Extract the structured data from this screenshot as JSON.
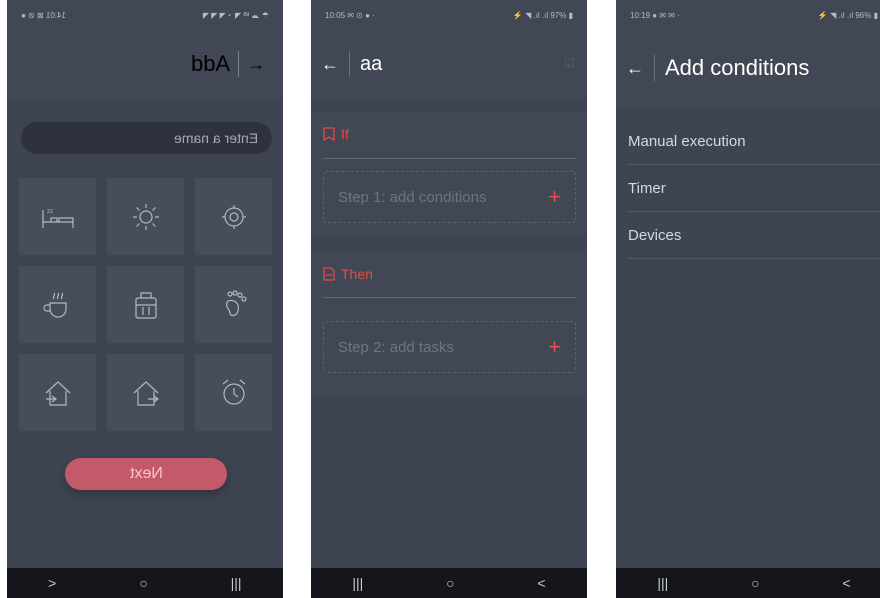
{
  "screen1": {
    "status": {
      "left": "14:01 ⊠ ⊘ ●",
      "right": "☂ ☁ ᵏᴮ ◥ ◔ ◥ ◥ ◥"
    },
    "title": "Add",
    "name_placeholder": "Enter a name",
    "tiles": [
      "bed-icon",
      "sun-icon",
      "gear-sun-icon",
      "coffee-icon",
      "luggage-icon",
      "footprint-icon",
      "home-in-icon",
      "home-out-icon",
      "alarm-clock-icon"
    ],
    "next_label": "Next",
    "nav": [
      "<",
      "○",
      "|||"
    ]
  },
  "screen2": {
    "status": {
      "left": "10:05 ✉ ⊙ ● ·",
      "right": "⚡ ◥ .ıl .ıl 97% ▮"
    },
    "title": "aa",
    "if_label": "If",
    "step1": "Step 1: add conditions",
    "then_label": "Then",
    "step2": "Step 2: add tasks",
    "nav": [
      "|||",
      "○",
      "<"
    ]
  },
  "screen3": {
    "status": {
      "left": "10:19 ● ✉ ✉ ·",
      "right": "⚡ ◥ .ıl .ıl 96% ▮"
    },
    "title": "Add conditions",
    "conditions": [
      "Manual execution",
      "Timer",
      "Devices"
    ],
    "nav": [
      "|||",
      "○",
      "<"
    ]
  },
  "colors": {
    "background": "#3e4452",
    "accent": "#e64a4a",
    "next": "#c45a69"
  }
}
